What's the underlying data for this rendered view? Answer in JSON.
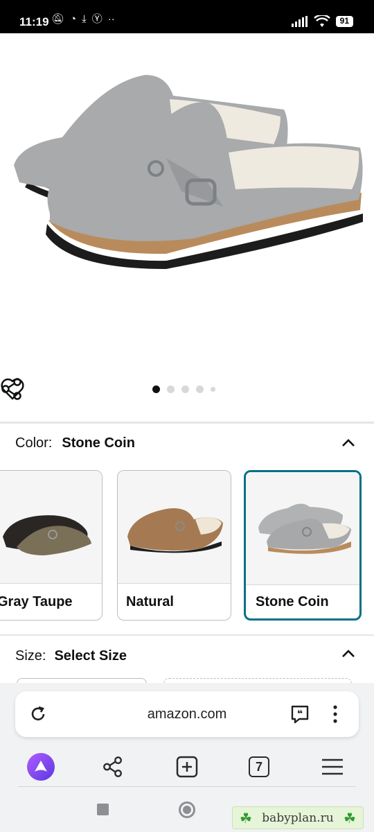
{
  "status_bar": {
    "time": "11:19",
    "battery": "91"
  },
  "product": {
    "image_count": 5,
    "active_image_index": 0,
    "colors": [
      "#a6a8a9",
      "#b98b5c",
      "#2a2a2a"
    ]
  },
  "color_section": {
    "label": "Color:",
    "selected": "Stone Coin",
    "swatches": [
      {
        "name": "Gray Taupe"
      },
      {
        "name": "Natural"
      },
      {
        "name": "Stone Coin"
      }
    ]
  },
  "size_section": {
    "label": "Size:",
    "value": "Select Size"
  },
  "browser": {
    "url": "amazon.com",
    "tab_count": "7",
    "accent": "#7b3fe4"
  },
  "watermark": {
    "text": "babyplan.ru"
  }
}
